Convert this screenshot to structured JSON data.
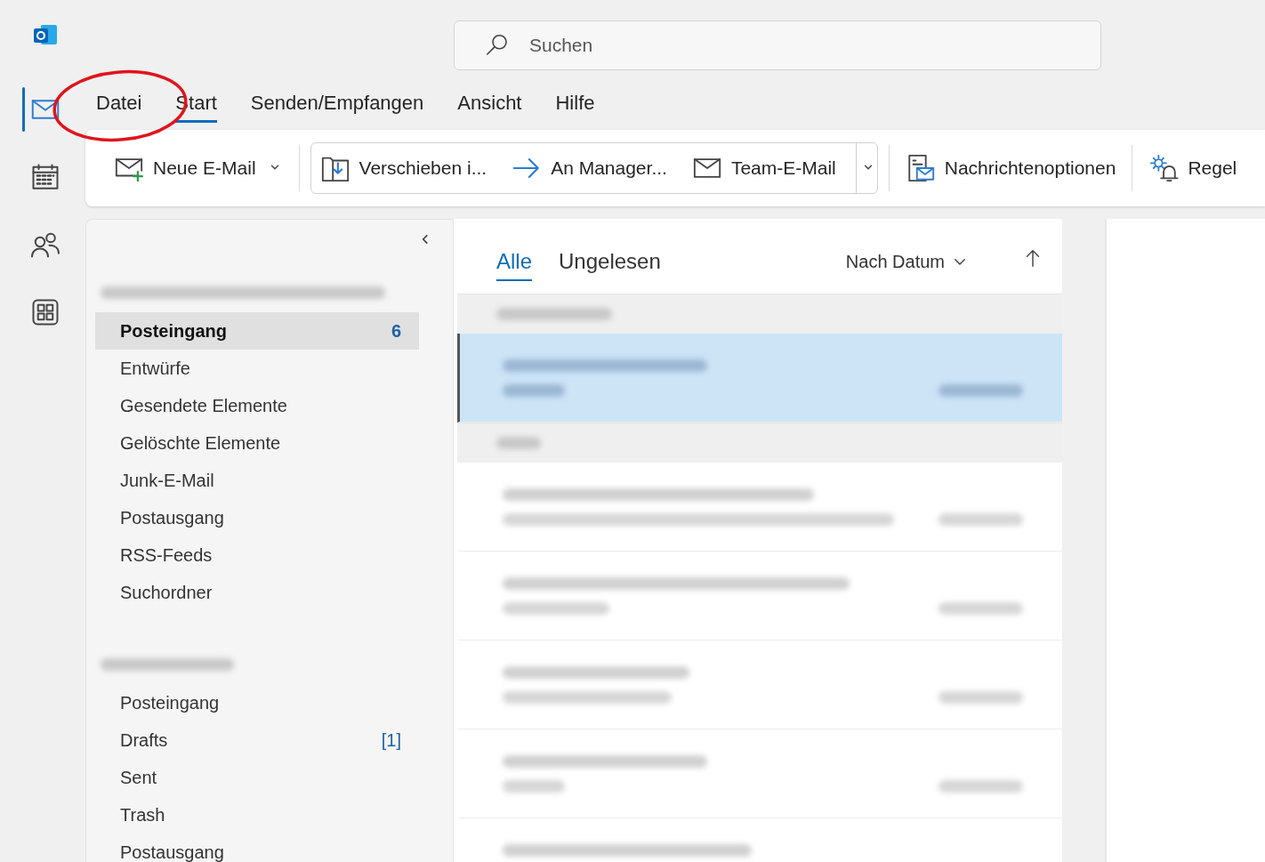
{
  "search": {
    "placeholder": "Suchen"
  },
  "rail": [
    {
      "kind": "mail",
      "selected": true
    },
    {
      "kind": "calendar",
      "selected": false
    },
    {
      "kind": "people",
      "selected": false
    },
    {
      "kind": "apps",
      "selected": false
    }
  ],
  "menu_tabs": [
    {
      "label": "Datei",
      "selected": false
    },
    {
      "label": "Start",
      "selected": true
    },
    {
      "label": "Senden/Empfangen",
      "selected": false
    },
    {
      "label": "Ansicht",
      "selected": false
    },
    {
      "label": "Hilfe",
      "selected": false
    }
  ],
  "annotation": {
    "kind": "circle"
  },
  "ribbon": {
    "new_mail": {
      "label": "Neue E-Mail",
      "kind": "new-mail"
    },
    "quick_steps": [
      {
        "label": "Verschieben i...",
        "kind": "move"
      },
      {
        "label": "An Manager...",
        "kind": "forward"
      },
      {
        "label": "Team-E-Mail",
        "kind": "mail"
      }
    ],
    "tools": [
      {
        "label": "Nachrichtenoptionen",
        "kind": "options"
      },
      {
        "label": "Regel",
        "kind": "rules"
      }
    ]
  },
  "folder_pane": {
    "accounts": [
      {
        "folders": [
          {
            "name": "Posteingang",
            "count": "6",
            "selected": true
          },
          {
            "name": "Entwürfe",
            "selected": false
          },
          {
            "name": "Gesendete Elemente",
            "selected": false
          },
          {
            "name": "Gelöschte Elemente",
            "selected": false
          },
          {
            "name": "Junk-E-Mail",
            "selected": false
          },
          {
            "name": "Postausgang",
            "selected": false
          },
          {
            "name": "RSS-Feeds",
            "selected": false
          },
          {
            "name": "Suchordner",
            "selected": false
          }
        ]
      },
      {
        "folders": [
          {
            "name": "Posteingang",
            "selected": false
          },
          {
            "name": "Drafts",
            "count": "[1]",
            "selected": false
          },
          {
            "name": "Sent",
            "selected": false
          },
          {
            "name": "Trash",
            "selected": false
          },
          {
            "name": "Postausgang",
            "selected": false
          }
        ]
      }
    ]
  },
  "message_list": {
    "tabs": [
      {
        "label": "Alle",
        "selected": true
      },
      {
        "label": "Ungelesen",
        "selected": false
      }
    ],
    "sort": "Nach Datum",
    "items": [
      {
        "kind": "group"
      },
      {
        "kind": "message",
        "selected": true
      },
      {
        "kind": "group"
      },
      {
        "kind": "message",
        "selected": false
      },
      {
        "kind": "message",
        "selected": false
      },
      {
        "kind": "message",
        "selected": false
      },
      {
        "kind": "message",
        "selected": false
      },
      {
        "kind": "message",
        "selected": false
      }
    ]
  }
}
